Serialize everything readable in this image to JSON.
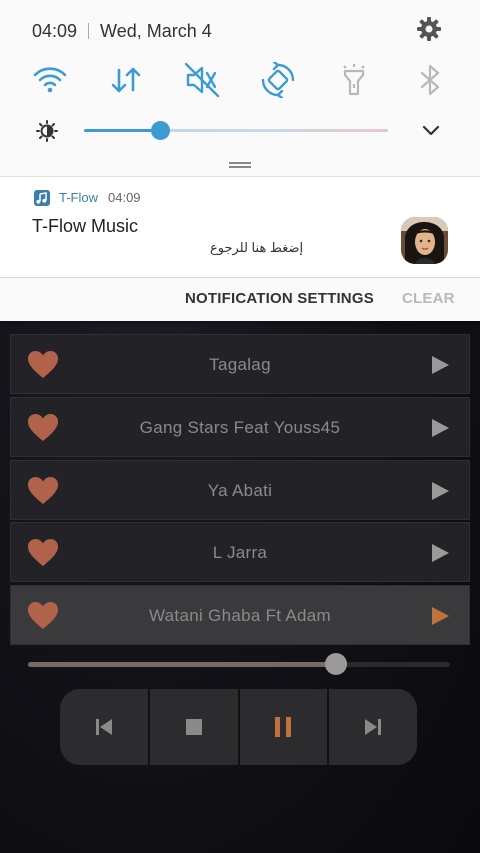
{
  "status": {
    "time": "04:09",
    "date": "Wed, March 4"
  },
  "quick_settings": [
    {
      "name": "wifi-icon",
      "state": "on"
    },
    {
      "name": "mobile-data-icon",
      "state": "on"
    },
    {
      "name": "sound-off-icon",
      "state": "on"
    },
    {
      "name": "auto-rotate-icon",
      "state": "on"
    },
    {
      "name": "flashlight-icon",
      "state": "off"
    },
    {
      "name": "bluetooth-icon",
      "state": "off"
    }
  ],
  "brightness": {
    "level": 0.25
  },
  "notification": {
    "app_name": "T-Flow",
    "time": "04:09",
    "title": "T-Flow Music",
    "text": "إضغط هنا للرجوع"
  },
  "shade_actions": {
    "settings_label": "NOTIFICATION SETTINGS",
    "clear_label": "CLEAR"
  },
  "songs": [
    {
      "title": "Tagalag"
    },
    {
      "title": "Gang Stars Feat Youss45"
    },
    {
      "title": "Ya Abati"
    },
    {
      "title": "L Jarra"
    },
    {
      "title": "Watani Ghaba Ft Adam"
    }
  ],
  "player": {
    "progress": 0.73,
    "state": "playing"
  },
  "colors": {
    "accent": "#3d9bd4",
    "heart": "#b0634a",
    "active_play": "#c0723e",
    "pause": "#c0723e"
  }
}
